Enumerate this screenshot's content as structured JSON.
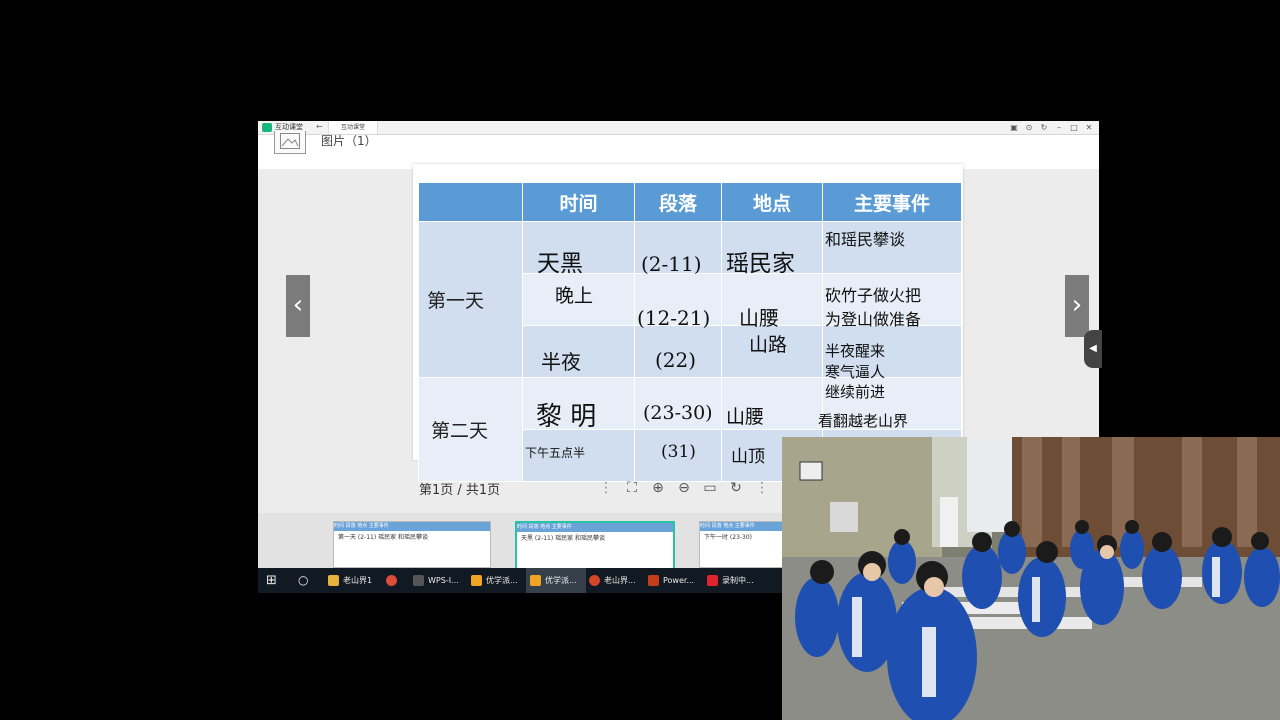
{
  "titlebar": {
    "app_name": "互动课堂",
    "back_icon": "arrow-left-icon",
    "tab_label": "互动课堂",
    "controls": [
      "▣",
      "⊙",
      "↻",
      "–",
      "□",
      "✕"
    ]
  },
  "header": {
    "label": "图片（1）"
  },
  "table": {
    "headers": [
      "",
      "时间",
      "段落",
      "地点",
      "主要事件"
    ],
    "day1": "第一天",
    "day2": "第二天",
    "handwriting": [
      "天黑",
      "晚上",
      "半夜",
      "黎 明",
      "下午五点半",
      "(2-11)",
      "(12-21)",
      "(22)",
      "(23-30)",
      "(31)",
      "瑶民家",
      "山腰",
      "山路",
      "山腰",
      "山顶",
      "和瑶民攀谈",
      "砍竹子做火把",
      "为登山做准备",
      "半夜醒来",
      "寒气逼人",
      "继续前进",
      "看翻越老山界"
    ]
  },
  "pagebar": {
    "page_info": "第1页 / 共1页"
  },
  "thumbnails": [
    {
      "head": "时间  段落  地点  主要事件",
      "body": "第一天  (2-11) 瑶民家 和瑶民攀谈"
    },
    {
      "head": "时间  段落  地点  主要事件",
      "body": "天黑  (2-11) 瑶民家 和瑶民攀谈"
    },
    {
      "head": "时间  段落  地点  主要事件",
      "body": "下午一时  (23-30)"
    }
  ],
  "taskbar": {
    "items": [
      {
        "label": "老山界1",
        "color": "#e8b13a"
      },
      {
        "label": "",
        "color": "#dd4b39"
      },
      {
        "label": "WPS-I...",
        "color": "#333333"
      },
      {
        "label": "优学派...",
        "color": "#f0a623"
      },
      {
        "label": "优学派...",
        "color": "#f0a623"
      },
      {
        "label": "老山界...",
        "color": "#d24726"
      },
      {
        "label": "Power...",
        "color": "#c43e1c"
      },
      {
        "label": "录制中...",
        "color": "#e0242f"
      }
    ]
  }
}
